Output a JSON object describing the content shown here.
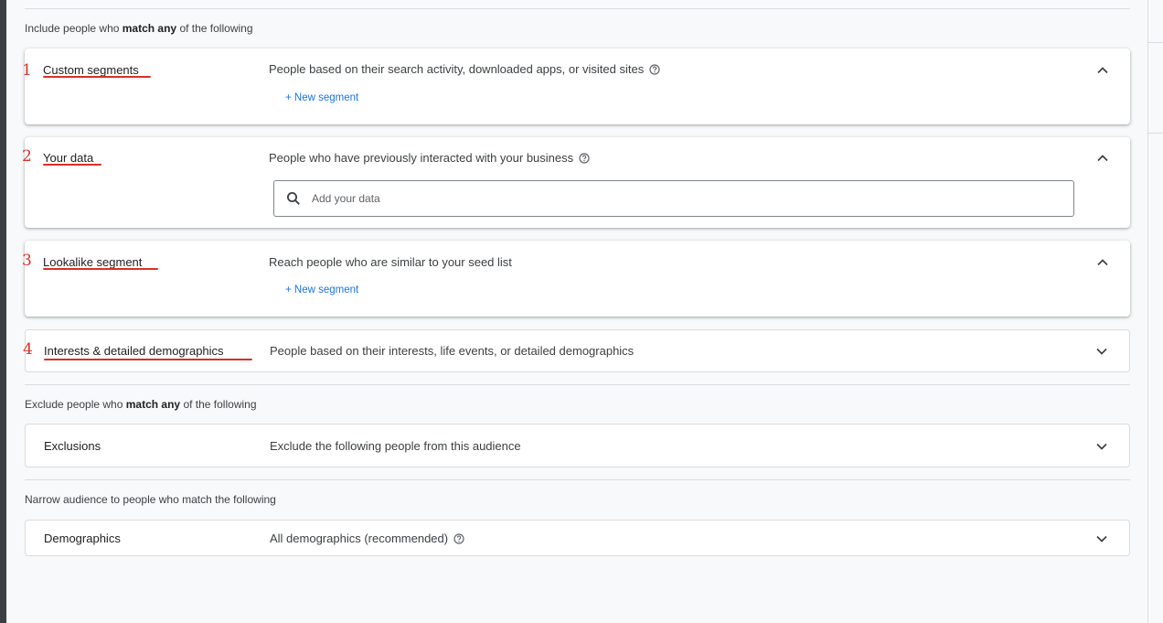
{
  "include_label": {
    "prefix": "Include people who ",
    "bold": "match any",
    "suffix": " of the following"
  },
  "cards": {
    "custom": {
      "number": "1",
      "title": "Custom segments",
      "desc": "People based on their search activity, downloaded apps, or visited sites",
      "action": "+ New segment"
    },
    "yourdata": {
      "number": "2",
      "title": "Your data",
      "desc": "People who have previously interacted with your business",
      "placeholder": "Add your data"
    },
    "lookalike": {
      "number": "3",
      "title": "Lookalike segment",
      "desc": "Reach people who are similar to your seed list",
      "action": "+ New segment"
    },
    "interests": {
      "number": "4",
      "title": "Interests & detailed demographics",
      "desc": "People based on their interests, life events, or detailed demographics"
    }
  },
  "exclude_label": {
    "prefix": "Exclude people who ",
    "bold": "match any",
    "suffix": " of the following"
  },
  "exclusions": {
    "title": "Exclusions",
    "desc": "Exclude the following people from this audience"
  },
  "narrow_label": "Narrow audience to people who match the following",
  "demographics": {
    "title": "Demographics",
    "desc": "All demographics (recommended)"
  },
  "colors": {
    "accent": "#1a73e8",
    "annotation": "#d93025",
    "text": "#3c4043"
  },
  "icons": {
    "help": "help-circle-icon",
    "expand": "chevron-down-icon",
    "collapse": "chevron-up-icon",
    "search": "search-icon"
  }
}
